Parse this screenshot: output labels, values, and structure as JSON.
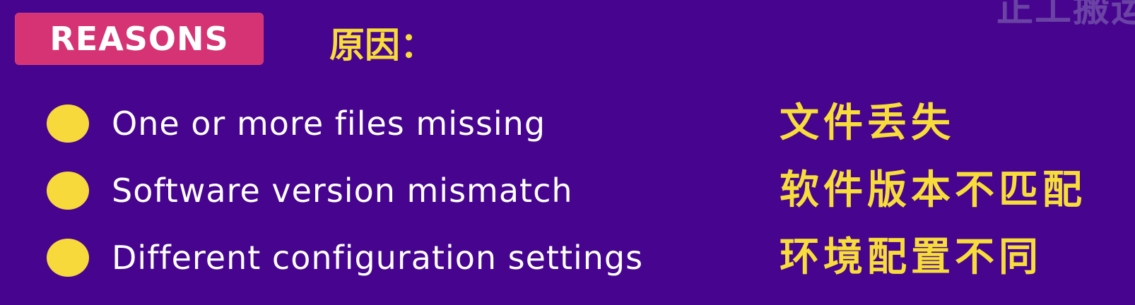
{
  "watermark": "正工搬运",
  "badge": {
    "label": "REASONS"
  },
  "header_cn": "原因：",
  "items": [
    {
      "en": "One or more files missing",
      "cn": "文件丢失"
    },
    {
      "en": "Software version mismatch",
      "cn": "软件版本不匹配"
    },
    {
      "en": "Different configuration settings",
      "cn": "环境配置不同"
    }
  ],
  "colors": {
    "background": "#46048f",
    "badge": "#d63374",
    "accent_yellow": "#f7dc3a",
    "text_white": "#ffffff"
  }
}
